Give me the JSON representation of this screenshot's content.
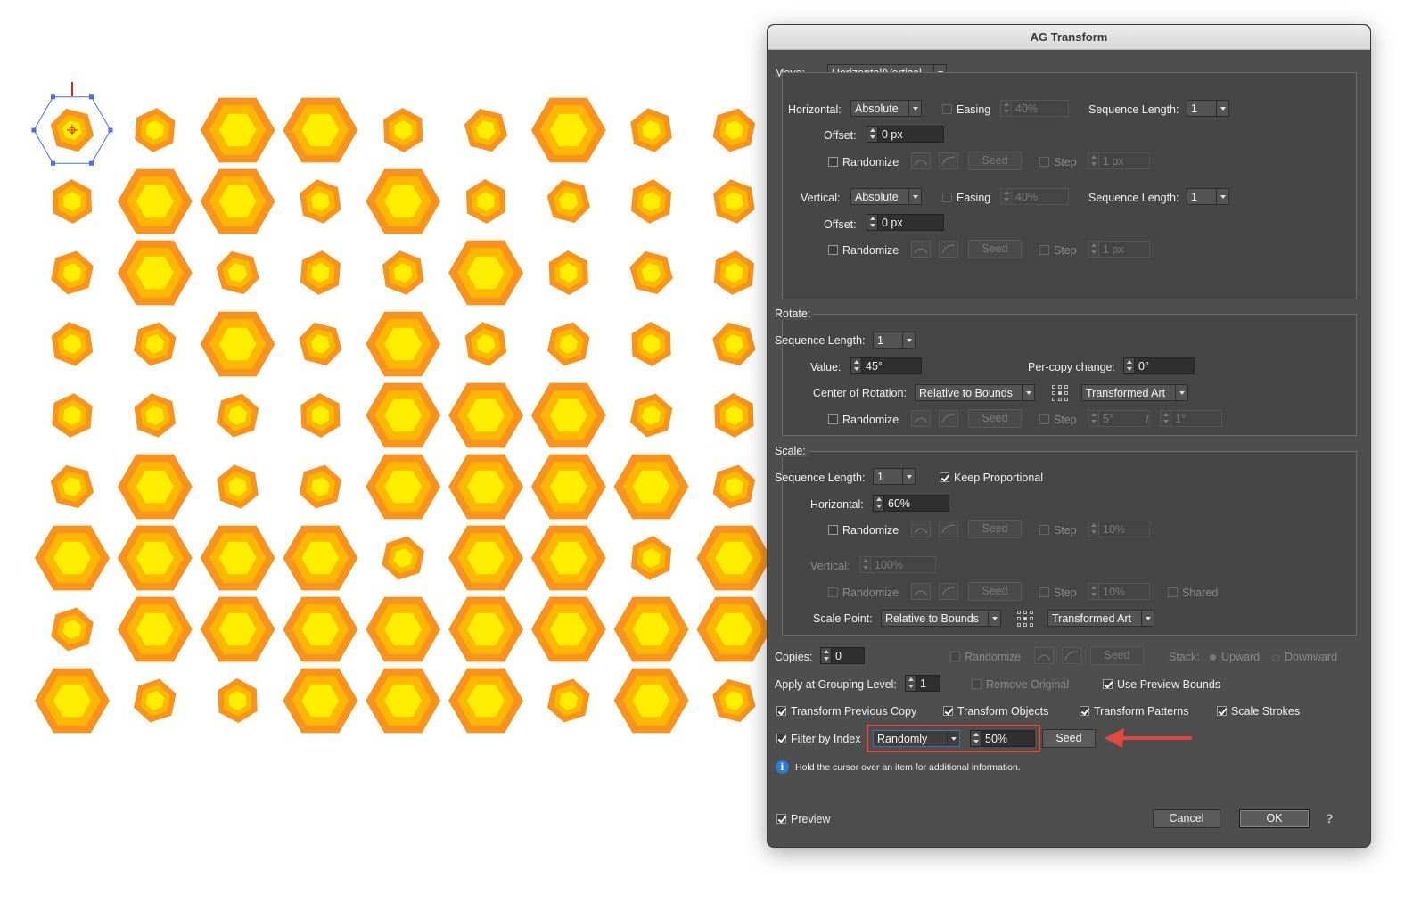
{
  "canvas": {
    "hexagons": [
      [
        "sel",
        "s",
        "l",
        "l",
        "s",
        "s",
        "l",
        "s",
        "s"
      ],
      [
        "s",
        "l",
        "l",
        "s",
        "l",
        "s",
        "s",
        "s",
        "s"
      ],
      [
        "s",
        "l",
        "s",
        "s",
        "s",
        "l",
        "s",
        "s",
        "s"
      ],
      [
        "s",
        "s",
        "l",
        "s",
        "l",
        "s",
        "s",
        "s",
        "s"
      ],
      [
        "s",
        "s",
        "s",
        "s",
        "l",
        "l",
        "l",
        "s",
        "s"
      ],
      [
        "s",
        "l",
        "s",
        "s",
        "l",
        "l",
        "l",
        "l",
        "s"
      ],
      [
        "l",
        "l",
        "l",
        "l",
        "s",
        "l",
        "l",
        "s",
        "l"
      ],
      [
        "s",
        "l",
        "l",
        "l",
        "l",
        "l",
        "l",
        "l",
        "l"
      ],
      [
        "l",
        "s",
        "s",
        "l",
        "l",
        "l",
        "s",
        "l",
        "s"
      ]
    ],
    "colors": {
      "outer": "#f7931e",
      "middle": "#ffb700",
      "inner": "#ffee00",
      "selection": "#4a6cf7",
      "crosshair": "#e02020"
    }
  },
  "dialog": {
    "title": "AG Transform",
    "move": {
      "label": "Move:",
      "mode": "Horizontal/Vertical",
      "horizontal": {
        "label": "Horizontal:",
        "mode": "Absolute",
        "easing_label": "Easing",
        "easing_value": "40%",
        "seq_label": "Sequence Length:",
        "seq_value": "1",
        "offset_label": "Offset:",
        "offset_value": "0 px",
        "randomize_label": "Randomize",
        "seed_label": "Seed",
        "step_label": "Step",
        "step_value": "1 px"
      },
      "vertical": {
        "label": "Vertical:",
        "mode": "Absolute",
        "easing_label": "Easing",
        "easing_value": "40%",
        "seq_label": "Sequence Length:",
        "seq_value": "1",
        "offset_label": "Offset:",
        "offset_value": "0 px",
        "randomize_label": "Randomize",
        "seed_label": "Seed",
        "step_label": "Step",
        "step_value": "1 px"
      }
    },
    "rotate": {
      "title": "Rotate:",
      "seq_label": "Sequence Length:",
      "seq_value": "1",
      "value_label": "Value:",
      "value": "45°",
      "percopy_label": "Per-copy change:",
      "percopy_value": "0°",
      "center_label": "Center of Rotation:",
      "center_mode": "Relative to Bounds",
      "center_target": "Transformed Art",
      "randomize_label": "Randomize",
      "seed_label": "Seed",
      "step_label": "Step",
      "step_value": "5°",
      "slash": "/",
      "step_value2": "1°"
    },
    "scale": {
      "title": "Scale:",
      "seq_label": "Sequence Length:",
      "seq_value": "1",
      "keep_label": "Keep Proportional",
      "horizontal_label": "Horizontal:",
      "horizontal_value": "60%",
      "randomize_label": "Randomize",
      "seed_label": "Seed",
      "step_label": "Step",
      "step_value": "10%",
      "vertical_label": "Vertical:",
      "vertical_value": "100%",
      "shared_label": "Shared",
      "point_label": "Scale Point:",
      "point_mode": "Relative to Bounds",
      "point_target": "Transformed Art"
    },
    "copies": {
      "label": "Copies:",
      "value": "0",
      "randomize_label": "Randomize",
      "seed_label": "Seed",
      "stack_label": "Stack:",
      "upward_label": "Upward",
      "downward_label": "Downward"
    },
    "grouping": {
      "label": "Apply at Grouping Level:",
      "value": "1",
      "remove_label": "Remove Original",
      "preview_bounds_label": "Use Preview Bounds"
    },
    "options": {
      "prev_copy_label": "Transform Previous Copy",
      "objects_label": "Transform Objects",
      "patterns_label": "Transform Patterns",
      "strokes_label": "Scale Strokes"
    },
    "filter": {
      "label": "Filter by Index",
      "mode": "Randomly",
      "value": "50%",
      "seed_label": "Seed"
    },
    "info_text": "Hold the cursor over an item for additional information.",
    "footer": {
      "preview_label": "Preview",
      "cancel_label": "Cancel",
      "ok_label": "OK",
      "help_label": "?"
    },
    "highlight_color": "#e0493f"
  }
}
